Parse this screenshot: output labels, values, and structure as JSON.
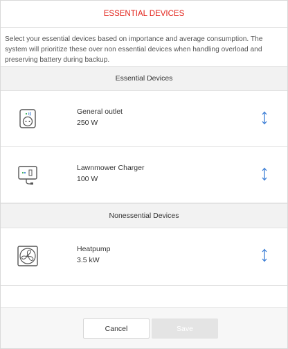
{
  "dialog": {
    "title": "ESSENTIAL DEVICES",
    "description": "Select your essential devices based on importance and average consumption. The system will prioritize these over non essential devices when handling overload and preserving battery during backup."
  },
  "sections": {
    "essential": {
      "header": "Essential Devices",
      "devices": [
        {
          "name": "General outlet",
          "power": "250 W",
          "icon": "outlet-icon"
        },
        {
          "name": "Lawnmower Charger",
          "power": "100 W",
          "icon": "charger-icon"
        }
      ]
    },
    "nonessential": {
      "header": "Nonessential Devices",
      "devices": [
        {
          "name": "Heatpump",
          "power": "3.5 kW",
          "icon": "fan-icon"
        }
      ]
    }
  },
  "footer": {
    "cancel_label": "Cancel",
    "save_label": "Save"
  },
  "colors": {
    "title": "#e2231a",
    "reorder_handle": "#3d7fd6",
    "save_disabled": "#e4e4e4"
  }
}
